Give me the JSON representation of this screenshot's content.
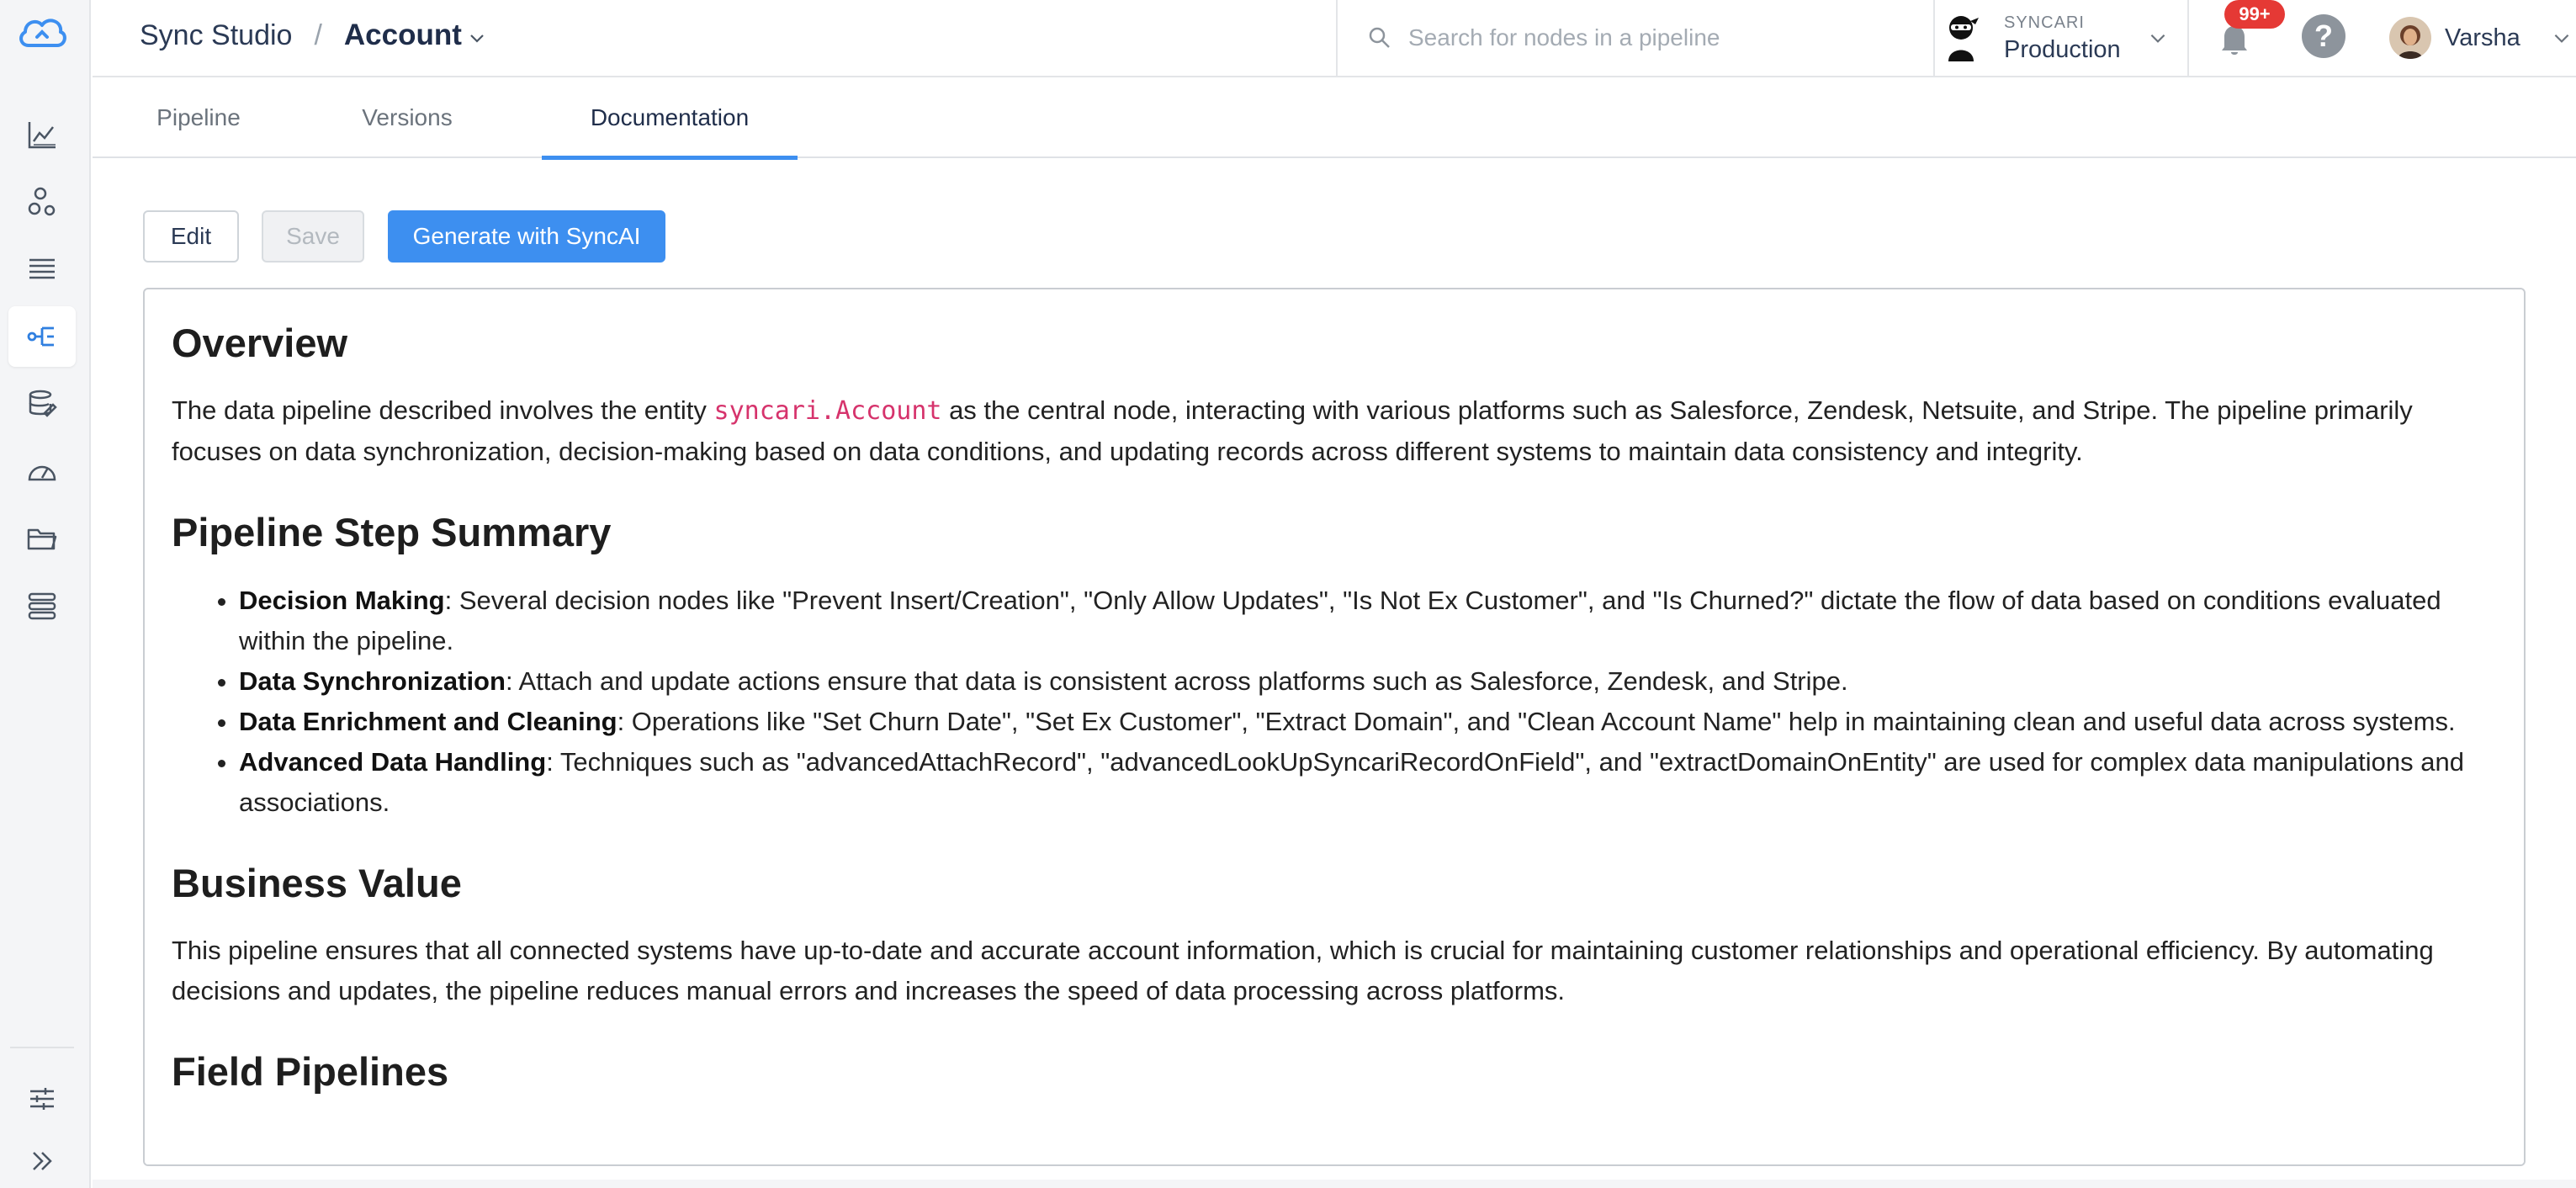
{
  "header": {
    "app": "Sync Studio",
    "separator": "/",
    "entity": "Account",
    "search_placeholder": "Search for nodes in a pipeline",
    "env_org": "SYNCARI",
    "env_name": "Production",
    "notifications_count": "99+",
    "help_glyph": "?",
    "user_name": "Varsha"
  },
  "tabs": [
    {
      "label": "Pipeline"
    },
    {
      "label": "Versions"
    },
    {
      "label": "Documentation"
    }
  ],
  "toolbar": {
    "edit_label": "Edit",
    "save_label": "Save",
    "generate_label": "Generate with SyncAI"
  },
  "sidebar_icons": [
    "cloud-logo-icon",
    "chart-icon",
    "nodes-icon",
    "list-icon",
    "pipeline-icon",
    "database-edit-icon",
    "gauge-icon",
    "folder-icon",
    "stack-icon",
    "sliders-icon",
    "expand-icon"
  ],
  "colors": {
    "accent": "#3d8ff0",
    "badge": "#e53935",
    "code": "#d6336c"
  },
  "doc": {
    "overview": {
      "heading": "Overview",
      "pre": "The data pipeline described involves the entity ",
      "code": "syncari.Account",
      "post": " as the central node, interacting with various platforms such as Salesforce, Zendesk, Netsuite, and Stripe. The pipeline primarily focuses on data synchronization, decision-making based on data conditions, and updating records across different systems to maintain data consistency and integrity."
    },
    "summary": {
      "heading": "Pipeline Step Summary",
      "items": [
        {
          "term": "Decision Making",
          "text": ": Several decision nodes like \"Prevent Insert/Creation\", \"Only Allow Updates\", \"Is Not Ex Customer\", and \"Is Churned?\" dictate the flow of data based on conditions evaluated within the pipeline."
        },
        {
          "term": "Data Synchronization",
          "text": ": Attach and update actions ensure that data is consistent across platforms such as Salesforce, Zendesk, and Stripe."
        },
        {
          "term": "Data Enrichment and Cleaning",
          "text": ": Operations like \"Set Churn Date\", \"Set Ex Customer\", \"Extract Domain\", and \"Clean Account Name\" help in maintaining clean and useful data across systems."
        },
        {
          "term": "Advanced Data Handling",
          "text": ": Techniques such as \"advancedAttachRecord\", \"advancedLookUpSyncariRecordOnField\", and \"extractDomainOnEntity\" are used for complex data manipulations and associations."
        }
      ]
    },
    "business": {
      "heading": "Business Value",
      "text": "This pipeline ensures that all connected systems have up-to-date and accurate account information, which is crucial for maintaining customer relationships and operational efficiency. By automating decisions and updates, the pipeline reduces manual errors and increases the speed of data processing across platforms."
    },
    "fields": {
      "heading": "Field Pipelines"
    }
  }
}
